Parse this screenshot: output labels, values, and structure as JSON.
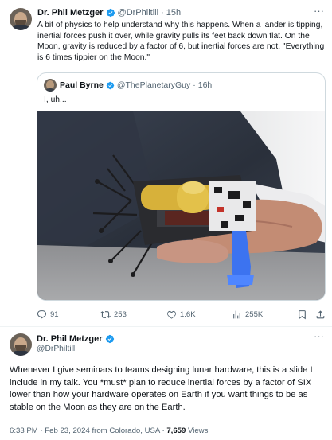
{
  "tweet": {
    "author_name": "Dr. Phil Metzger",
    "author_handle": "@DrPhiltill",
    "time": "15h",
    "text": "A bit of physics to help understand why this happens. When a lander is tipping, inertial forces push it over, while gravity pulls its feet back down flat. On the Moon, gravity is reduced by a factor of 6, but inertial forces are not. \"Everything is 6 times tippier on the Moon.\"",
    "quote": {
      "author_name": "Paul Byrne",
      "author_handle": "@ThePlanetaryGuy",
      "time": "16h",
      "text": "I, uh..."
    },
    "stats": {
      "replies": "91",
      "reposts": "253",
      "likes": "1.6K",
      "views": "255K"
    }
  },
  "reply": {
    "author_name": "Dr. Phil Metzger",
    "author_handle": "@DrPhiltill",
    "text": "Whenever I give seminars to teams designing lunar hardware, this is a slide I include in my talk. You *must* plan to reduce inertial forces by a factor of SIX lower than how your hardware operates on Earth if you want things to be as stable on the Moon as they are on the Earth.",
    "meta_time": "6:33 PM · Feb 23, 2024 from Colorado, USA · ",
    "views_count": "7,659",
    "views_label": " Views"
  },
  "separator": "·",
  "colors": {
    "verified": "#1d9bf0",
    "muted": "#536471",
    "text": "#0f1419",
    "border": "#cfd9de"
  },
  "icons": [
    "reply-icon",
    "repost-icon",
    "like-icon",
    "views-icon",
    "bookmark-icon",
    "share-icon",
    "verified-icon",
    "more-icon"
  ]
}
